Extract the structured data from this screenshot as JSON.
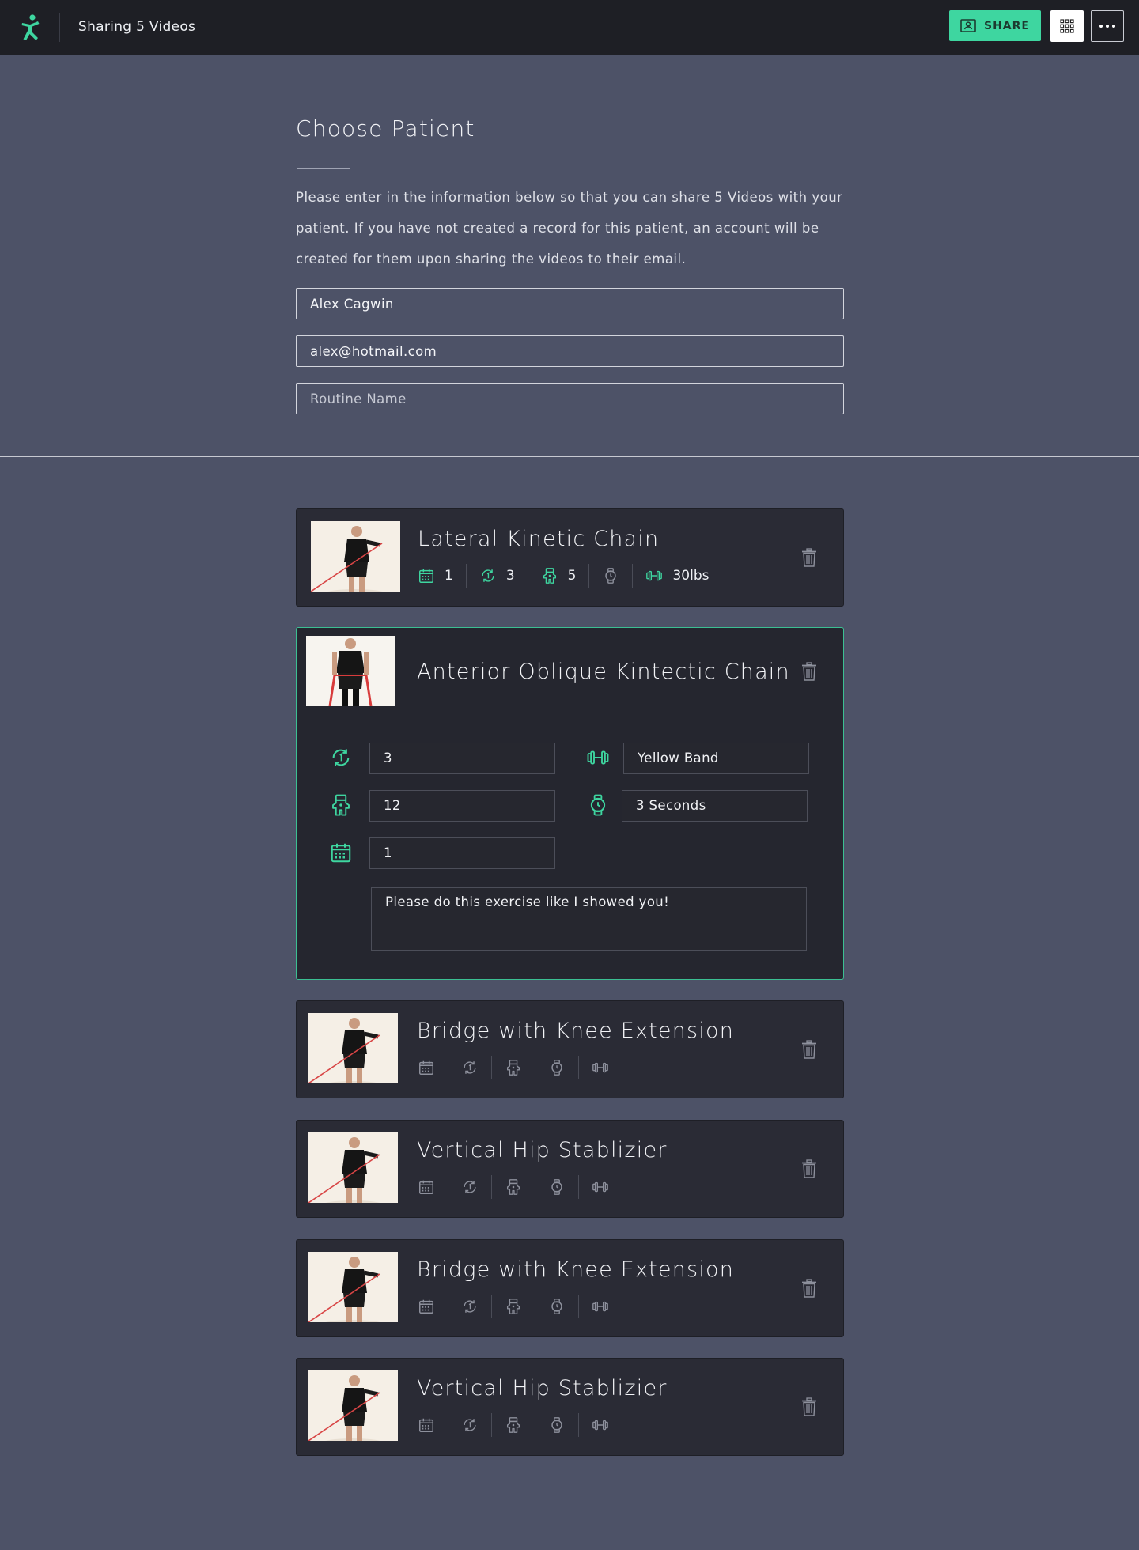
{
  "header": {
    "title": "Sharing 5 Videos",
    "share_label": "SHARE",
    "accent": "#3ed6a0"
  },
  "form": {
    "heading": "Choose Patient",
    "description": "Please enter in the information below so that you can share 5 Videos with your patient. If you have not created a record for this patient, an account will be created for them upon sharing the videos to their email.",
    "name_value": "Alex Cagwin",
    "email_value": "alex@hotmail.com",
    "routine_placeholder": "Routine Name"
  },
  "videos": [
    {
      "title": "Lateral Kinetic Chain",
      "meta": {
        "days": "1",
        "sets": "3",
        "reps": "5",
        "hold": "",
        "weight": "30lbs"
      }
    },
    {
      "title": "Anterior Oblique Kintectic Chain",
      "fields": {
        "sets": "3",
        "resistance": "Yellow Band",
        "reps": "12",
        "hold": "3 Seconds",
        "days": "1",
        "notes": "Please do this exercise like I showed you!"
      }
    },
    {
      "title": "Bridge with Knee Extension"
    },
    {
      "title": "Vertical Hip Stablizier"
    },
    {
      "title": "Bridge with Knee Extension"
    },
    {
      "title": "Vertical Hip Stablizier"
    }
  ]
}
